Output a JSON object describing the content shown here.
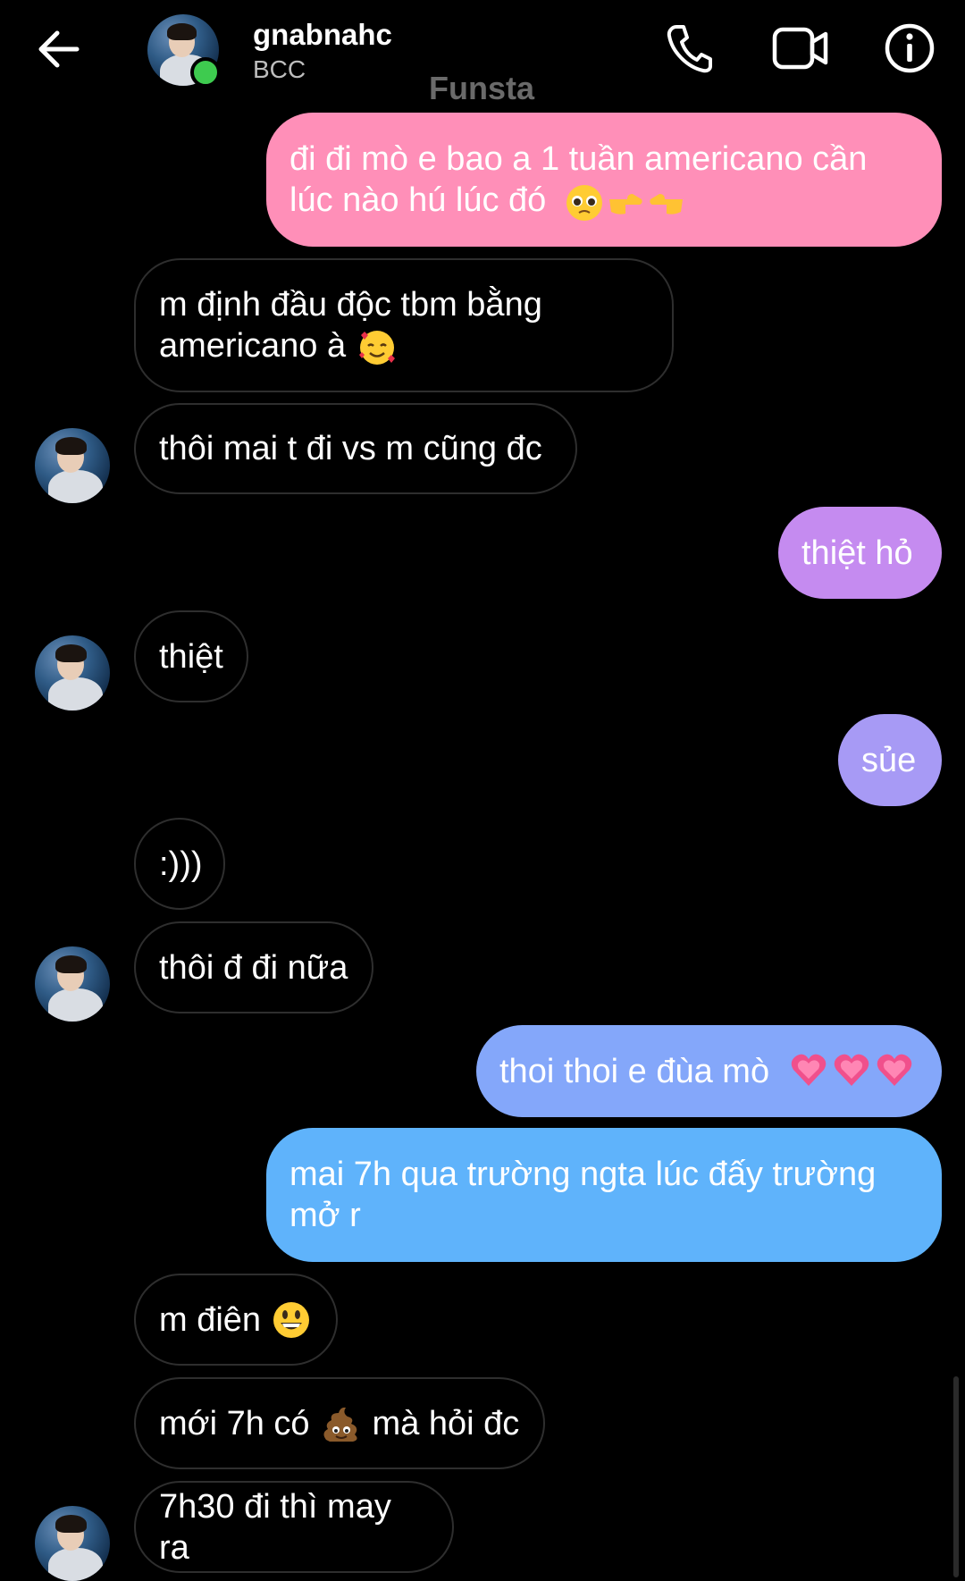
{
  "header": {
    "username": "gnabnahc",
    "subtitle": "BCC",
    "overlay_label": "Funsta",
    "icons": [
      "back-arrow-icon",
      "phone-icon",
      "video-icon",
      "info-icon"
    ]
  },
  "colors": {
    "bubble_pink": "#ff8fb8",
    "bubble_purple": "#c58bf0",
    "bubble_violet": "#a79af5",
    "bubble_blue": "#84a7fa",
    "bubble_lightblue": "#5fb3fb",
    "online": "#3ecb4f"
  },
  "messages": [
    {
      "from": "me",
      "text": "đi đi mò e bao a 1 tuần americano cần\nlúc nào hú lúc đó",
      "emojis": [
        "pleading-face-icon",
        "pointing-right-icon",
        "pointing-left-icon"
      ]
    },
    {
      "from": "them",
      "text": "m định đầu độc tbm bằng\namericano à",
      "emojis": [
        "smiling-hearts-face-icon"
      ]
    },
    {
      "from": "them",
      "text": "thôi mai t đi vs m cũng đc"
    },
    {
      "from": "me",
      "text": "thiệt hỏ"
    },
    {
      "from": "them",
      "text": "thiệt"
    },
    {
      "from": "me",
      "text": "sủe"
    },
    {
      "from": "them",
      "text": ":)))"
    },
    {
      "from": "them",
      "text": "thôi đ đi nữa"
    },
    {
      "from": "me",
      "text": "thoi thoi e đùa mò",
      "emojis": [
        "growing-heart-icon",
        "growing-heart-icon",
        "growing-heart-icon"
      ]
    },
    {
      "from": "me",
      "text": "mai 7h qua trường ngta lúc đấy trường\nmở r"
    },
    {
      "from": "them",
      "text": "m điên",
      "emojis": [
        "grinning-face-icon"
      ]
    },
    {
      "from": "them",
      "text": "mới 7h có",
      "text_after": "mà hỏi đc",
      "emojis": [
        "poop-icon"
      ]
    },
    {
      "from": "them",
      "text": "7h30 đi thì may ra"
    }
  ]
}
